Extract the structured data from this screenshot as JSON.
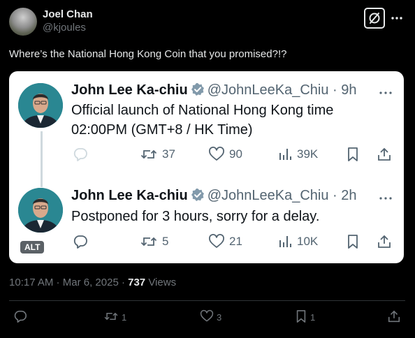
{
  "tweet": {
    "author_name": "Joel Chan",
    "author_handle": "@kjoules",
    "text": "Where’s the National Hong Kong Coin that you promised?!?",
    "time": "10:17 AM",
    "date": "Mar 6, 2025",
    "views_count": "737",
    "views_label": "Views",
    "replies": "",
    "retweets": "1",
    "likes": "3",
    "bookmarks": "1"
  },
  "embedded": {
    "alt_label": "ALT",
    "posts": [
      {
        "name": "John Lee Ka-chiu",
        "handle": "@JohnLeeKa_Chiu",
        "age": "9h",
        "line1": "Official launch of National Hong Kong time",
        "line2": "02:00PM (GMT+8 / HK  Time)",
        "replies": "",
        "retweets": "37",
        "likes": "90",
        "views": "39K"
      },
      {
        "name": "John Lee Ka-chiu",
        "handle": "@JohnLeeKa_Chiu",
        "age": "2h",
        "line1": "Postponed for 3 hours, sorry for a delay.",
        "line2": "",
        "replies": "",
        "retweets": "5",
        "likes": "21",
        "views": "10K"
      }
    ]
  },
  "icons": {
    "header": [
      "grok-icon",
      "more-icon"
    ],
    "actions": [
      "reply-icon",
      "retweet-icon",
      "like-icon",
      "views-icon",
      "bookmark-icon",
      "share-icon"
    ]
  },
  "colors": {
    "background": "#000000",
    "text_primary": "#e7e9ea",
    "text_secondary": "#71767b",
    "card_bg": "#ffffff",
    "verified": "#829aab",
    "card_icon": "#536471"
  }
}
